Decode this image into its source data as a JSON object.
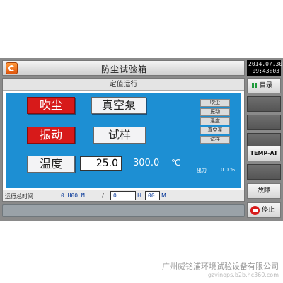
{
  "window": {
    "title": "防尘试验箱",
    "subtitle": "定值运行"
  },
  "clock": {
    "date": "2014.07.30",
    "time": "09:43:03"
  },
  "mode_buttons": {
    "dust": "吹尘",
    "vacuum_pump": "真空泵",
    "vibration": "振动",
    "sample": "试样",
    "temperature": "温度"
  },
  "temperature": {
    "setpoint": "25.0",
    "current": "300.0",
    "unit": "℃"
  },
  "status_indicators": [
    "吹尘",
    "振动",
    "温度",
    "真空泵",
    "试样"
  ],
  "output": {
    "label": "出力",
    "value": "0.0 %"
  },
  "runtime": {
    "label": "运行总时间",
    "total": "0 H00 M",
    "slash": "/",
    "hours_value": "0",
    "hours_unit": "H",
    "minutes_value": "00",
    "minutes_unit": "M"
  },
  "side_buttons": {
    "menu": "目录",
    "temp_at": "TEMP-AT",
    "fault": "故障",
    "stop": "停止"
  },
  "colors": {
    "panel_blue": "#1d8fd3",
    "active_red": "#d71a1a",
    "menu_dot_green": "#1e9a3a"
  },
  "footer": {
    "company": "广州威铭浦环境试验设备有限公司",
    "site_url": "gzvinops.b2b.hc360.com"
  }
}
